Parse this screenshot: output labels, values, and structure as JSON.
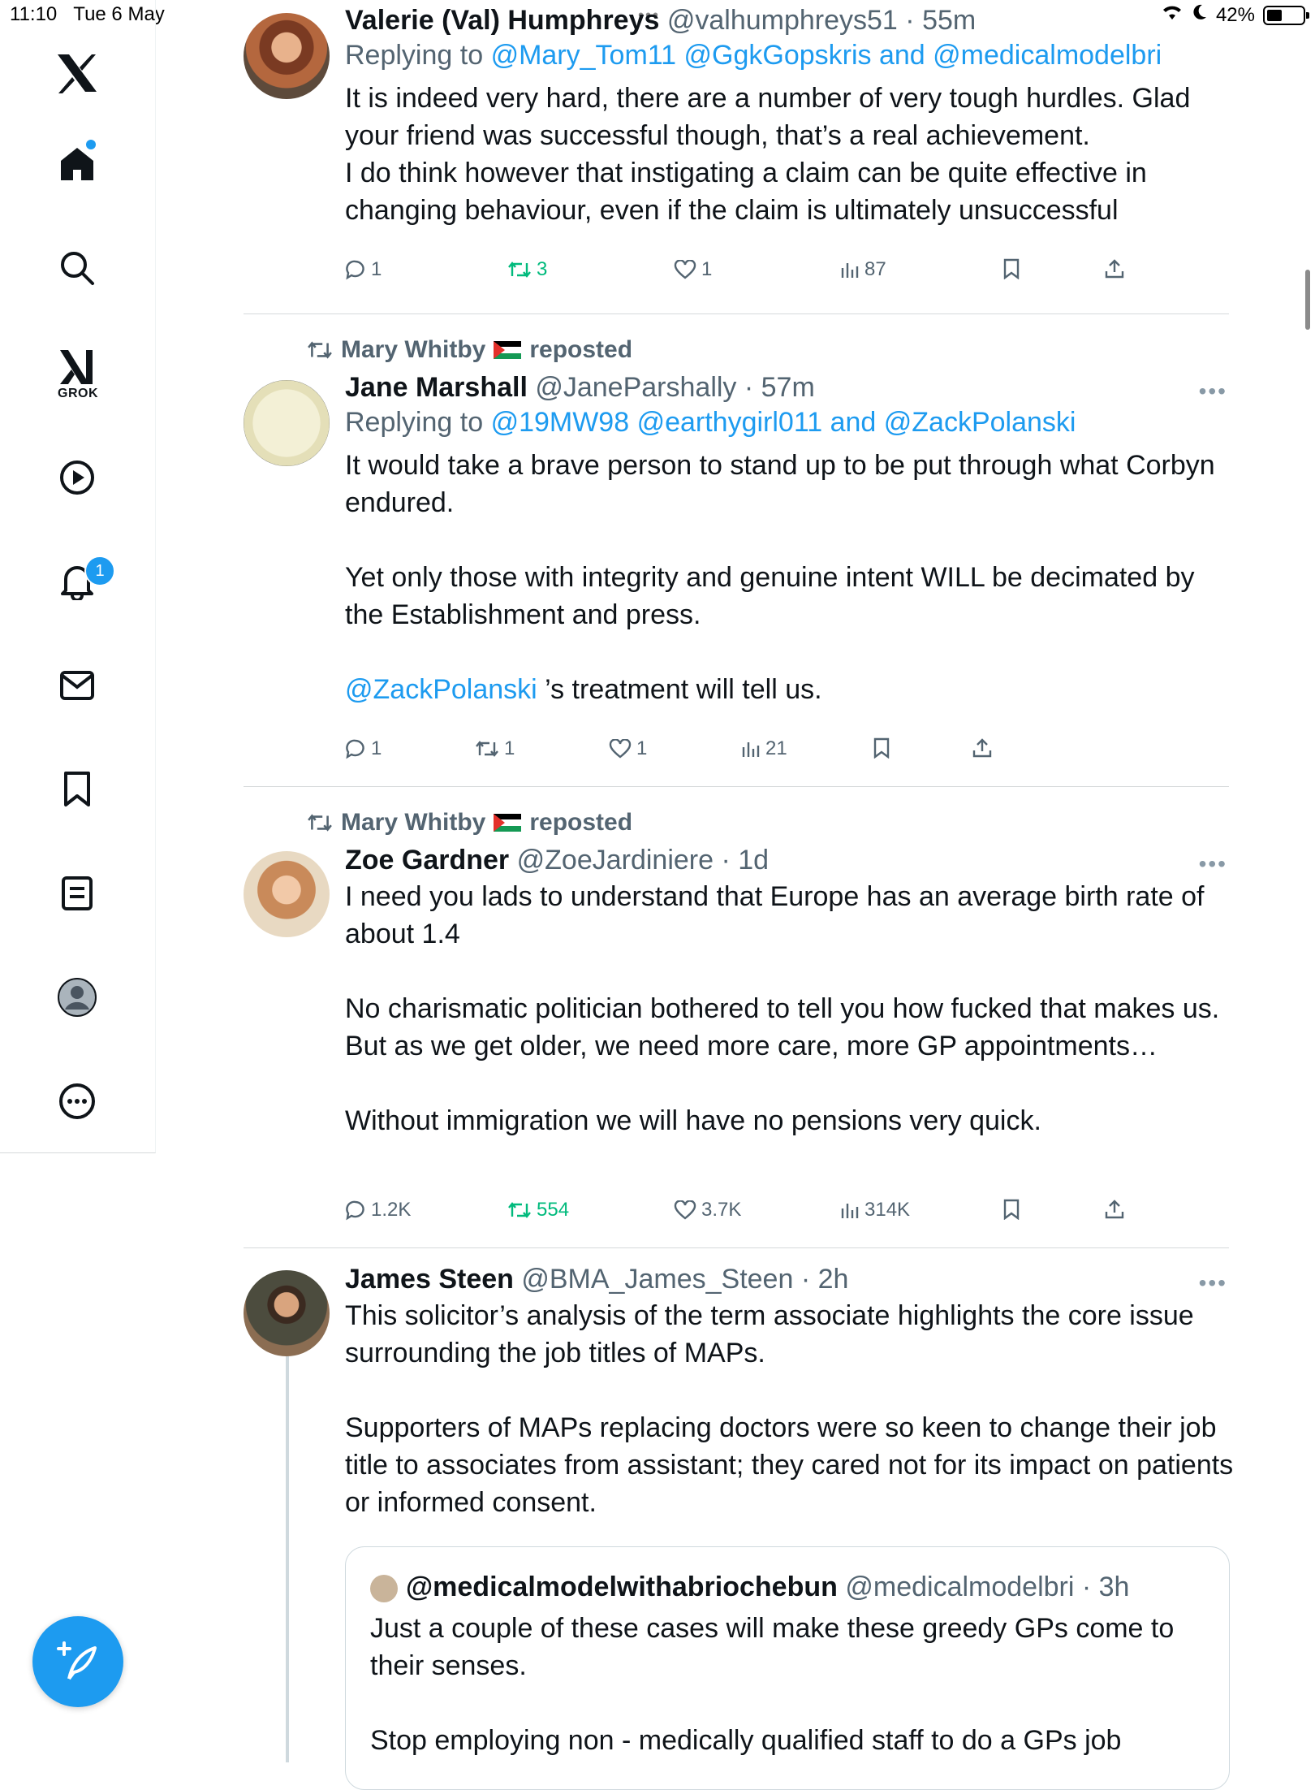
{
  "status_bar": {
    "time": "11:10",
    "date": "Tue 6 May",
    "battery": "42%"
  },
  "sidebar": {
    "grok_label": "GROK",
    "notification_count": "1"
  },
  "colors": {
    "accent": "#1d9bf0",
    "repost_green": "#00ba7c",
    "muted": "#536471"
  },
  "tweets": [
    {
      "name": "Valerie (Val) Humphreys",
      "handle": "@valhumphreys51",
      "time": "55m",
      "reply_prefix": "Replying to",
      "reply_mentions": "@Mary_Tom11 @GgkGopskris and @medicalmodelbri",
      "body": "It is indeed very hard, there are a number of very tough hurdles. Glad your friend was successful though, that’s a real achievement.\nI do think however that instigating a claim can be quite effective in changing behaviour, even if the claim is ultimately unsuccessful",
      "replies": "1",
      "reposts": "3",
      "likes": "1",
      "views": "87"
    },
    {
      "reposted_by": "Mary Whitby",
      "reposted_label": "reposted",
      "name": "Jane Marshall",
      "handle": "@JaneParshally",
      "time": "57m",
      "reply_prefix": "Replying to",
      "reply_mentions": "@19MW98 @earthygirl011 and @ZackPolanski",
      "body": "It would take a brave person to stand up to be put through what Corbyn endured.\n\nYet only those with integrity and genuine intent WILL be decimated by the Establishment and press.",
      "body_mention": "@ZackPolanski",
      "body_tail": " ’s treatment will tell us.",
      "replies": "1",
      "reposts": "1",
      "likes": "1",
      "views": "21"
    },
    {
      "reposted_by": "Mary Whitby",
      "reposted_label": "reposted",
      "name": "Zoe Gardner",
      "handle": "@ZoeJardiniere",
      "time": "1d",
      "body": "I need you lads to understand that Europe has an average birth rate of about 1.4\n\nNo charismatic politician bothered to tell you how fucked that makes us.\nBut as we get older, we need more care, more GP appointments…\n\nWithout immigration we will have no pensions very quick.",
      "replies": "1.2K",
      "reposts": "554",
      "likes": "3.7K",
      "views": "314K"
    },
    {
      "name": "James Steen",
      "handle": "@BMA_James_Steen",
      "time": "2h",
      "body": "This solicitor’s analysis of the term associate highlights the core issue surrounding the job titles of MAPs.\n\nSupporters of MAPs replacing doctors were so keen to change their job title to associates from assistant; they cared not for its impact on patients or informed consent.",
      "quote": {
        "name": "@medicalmodelwithabriochebun",
        "handle": "@medicalmodelbri",
        "time": "3h",
        "body": "Just a couple of these cases will make these greedy GPs come to their senses.\n\nStop employing non - medically qualified staff to do a GPs job"
      }
    }
  ]
}
